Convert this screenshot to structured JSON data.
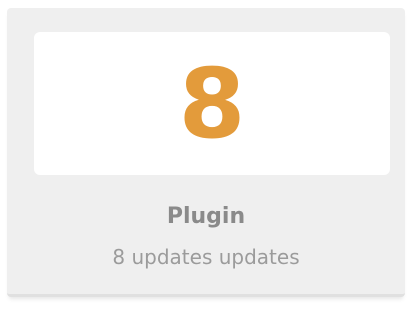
{
  "widget": {
    "count": "8",
    "title": "Plugin",
    "subtitle": "8 updates updates",
    "accent_color": "#e39b3b"
  }
}
